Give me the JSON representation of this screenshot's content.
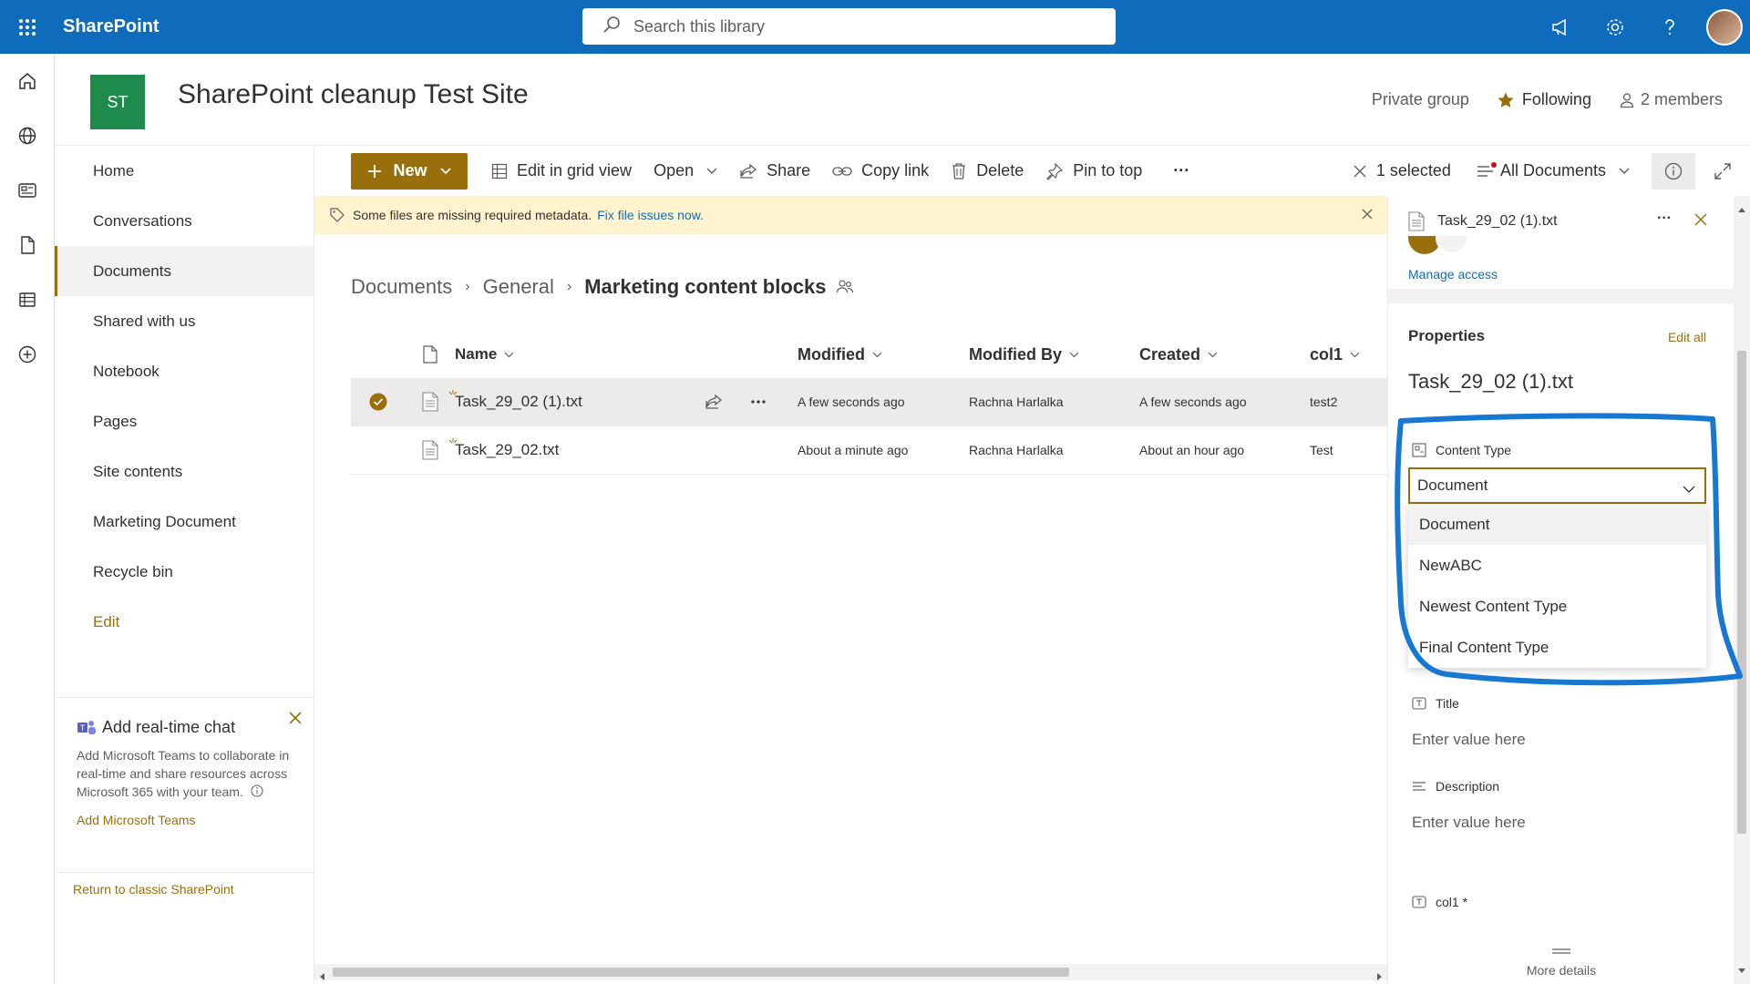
{
  "suite": {
    "brand": "SharePoint",
    "search_placeholder": "Search this library"
  },
  "site": {
    "logo": "ST",
    "title": "SharePoint cleanup Test Site",
    "privacy": "Private group",
    "following": "Following",
    "members": "2 members"
  },
  "nav": {
    "items": [
      "Home",
      "Conversations",
      "Documents",
      "Shared with us",
      "Notebook",
      "Pages",
      "Site contents",
      "Marketing Document",
      "Recycle bin"
    ],
    "edit": "Edit"
  },
  "chat": {
    "title": "Add real-time chat",
    "body": "Add Microsoft Teams to collaborate in real-time and share resources across Microsoft 365 with your team.",
    "link": "Add Microsoft Teams"
  },
  "classic_link": "Return to classic SharePoint",
  "commands": {
    "new": "New",
    "grid": "Edit in grid view",
    "open": "Open",
    "share": "Share",
    "copy_link": "Copy link",
    "delete": "Delete",
    "pin": "Pin to top",
    "more": "···",
    "selected": "1 selected",
    "view": "All Documents"
  },
  "banner": {
    "text": "Some files are missing required metadata.",
    "link": "Fix file issues now."
  },
  "breadcrumb": {
    "items": [
      "Documents",
      "General"
    ],
    "current": "Marketing content blocks",
    "separator": "›"
  },
  "table": {
    "columns": [
      "Name",
      "Modified",
      "Modified By",
      "Created",
      "col1"
    ],
    "rows": [
      {
        "name": "Task_29_02 (1).txt",
        "modified": "A few seconds ago",
        "modified_by": "Rachna Harlalka",
        "created": "A few seconds ago",
        "col1": "test2"
      },
      {
        "name": "Task_29_02.txt",
        "modified": "About a minute ago",
        "modified_by": "Rachna Harlalka",
        "created": "About an hour ago",
        "col1": "Test"
      }
    ]
  },
  "pane": {
    "file_name": "Task_29_02 (1).txt",
    "more": "···",
    "manage_access": "Manage access",
    "properties": "Properties",
    "edit_all": "Edit all",
    "props_file": "Task_29_02 (1).txt",
    "content_type_label": "Content Type",
    "content_type_value": "Document",
    "content_type_options": [
      "Document",
      "NewABC",
      "Newest Content Type",
      "Final Content Type"
    ],
    "title_label": "Title",
    "title_placeholder": "Enter value here",
    "description_label": "Description",
    "description_placeholder": "Enter value here",
    "col1_label": "col1 *",
    "more_details": "More details"
  },
  "colors": {
    "suite_bar": "#0f6cbd",
    "accent": "#986f0b",
    "site_logo": "#1e8a4c",
    "banner": "#fff4ce",
    "highlight_stroke": "#1778d4"
  }
}
